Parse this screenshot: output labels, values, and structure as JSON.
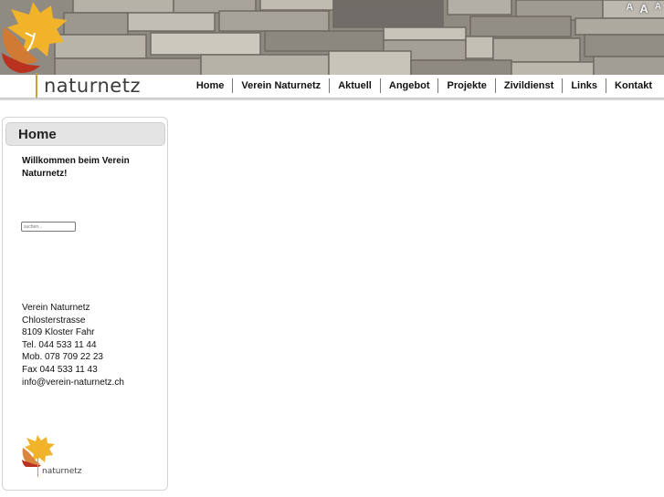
{
  "site": {
    "brand": "naturnetz",
    "font_size_controls": [
      "A",
      "A",
      "A"
    ]
  },
  "nav": {
    "items": [
      "Home",
      "Verein Naturnetz",
      "Aktuell",
      "Angebot",
      "Projekte",
      "Zivildienst",
      "Links",
      "Kontakt"
    ]
  },
  "sidebar": {
    "title": "Home",
    "welcome": "Willkommen beim Verein Naturnetz!",
    "search_placeholder": "suchen...",
    "contact": {
      "org": "Verein Naturnetz",
      "street": "Chlosterstrasse",
      "city": "8109 Kloster Fahr",
      "tel": "Tel. 044 533 11 44",
      "mob": "Mob. 078 709 22 23",
      "fax": "Fax 044 533 11 43",
      "email": "info@verein-naturnetz.ch"
    },
    "footer_brand": "naturnetz"
  },
  "colors": {
    "leaf_yellow": "#f0b32a",
    "leaf_red": "#b8321f",
    "leaf_orange": "#d7782a",
    "accent_line": "#c8a13a"
  },
  "icons": {
    "logo": "leaf-logo-icon"
  }
}
